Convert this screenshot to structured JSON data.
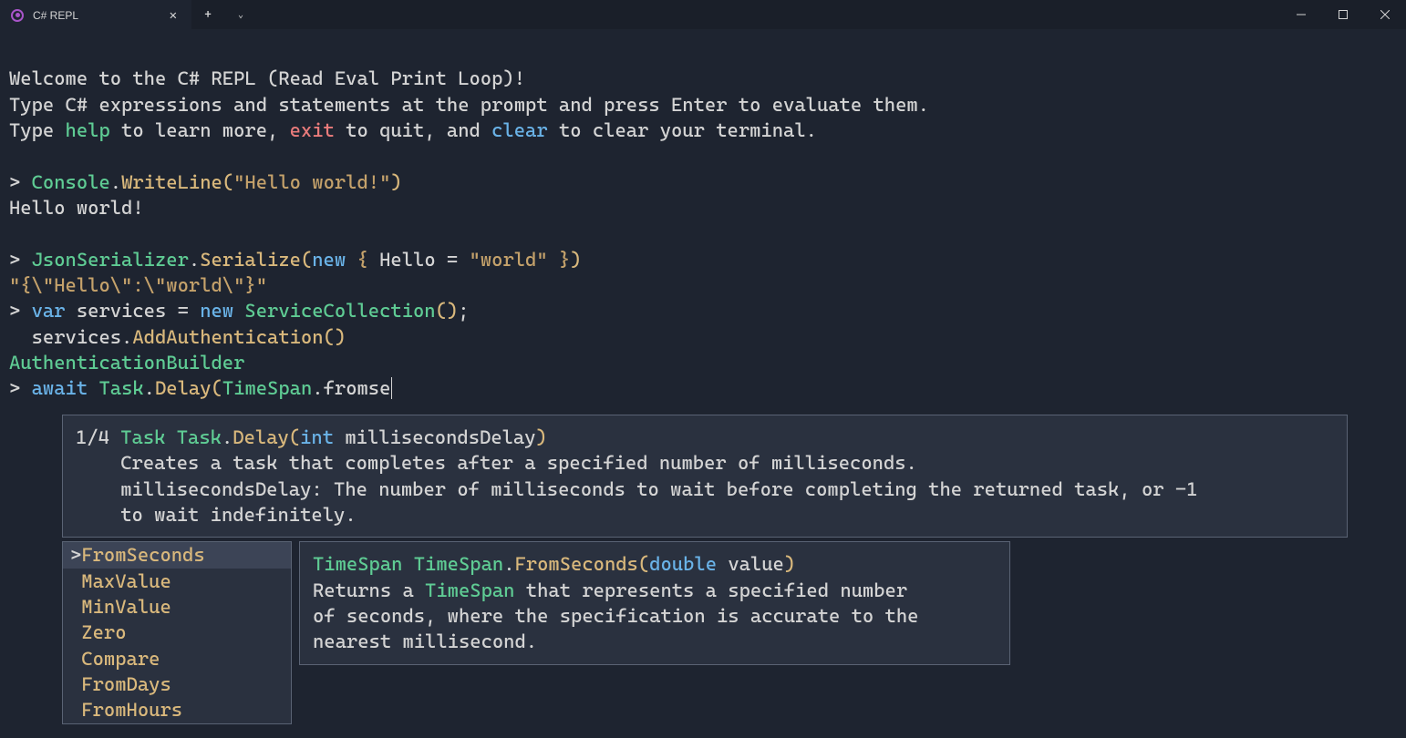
{
  "titlebar": {
    "tab_title": "C# REPL"
  },
  "intro": {
    "line1_a": "Welcome to the C# REPL (Read Eval Print Loop)!",
    "line2_a": "Type C# expressions and statements at the prompt and press Enter to evaluate them.",
    "line3_prefix": "Type ",
    "help": "help",
    "line3_mid1": " to learn more, ",
    "exit": "exit",
    "line3_mid2": " to quit, and ",
    "clear": "clear",
    "line3_suffix": " to clear your terminal."
  },
  "prompts": {
    "p": "> "
  },
  "cmd1": {
    "cls": "Console",
    "dot1": ".",
    "meth": "WriteLine",
    "open": "(",
    "str": "\"Hello world!\"",
    "close": ")",
    "output": "Hello world!"
  },
  "cmd2": {
    "cls": "JsonSerializer",
    "dot1": ".",
    "meth": "Serialize",
    "open": "(",
    "kw": "new",
    "sp": " ",
    "brace_o": "{ ",
    "prop": "Hello ",
    "eq": "= ",
    "str": "\"world\"",
    "brace_c": " }",
    "close": ")",
    "output": "\"{\\\"Hello\\\":\\\"world\\\"}\""
  },
  "cmd3": {
    "kw1": "var",
    "sp1": " services ",
    "eq": "= ",
    "kw2": "new",
    "sp2": " ",
    "cls": "ServiceCollection",
    "paren": "()",
    "semi": ";",
    "indent": "  services",
    "dot": ".",
    "meth": "AddAuthentication",
    "paren2": "()",
    "output": "AuthenticationBuilder"
  },
  "cmd4": {
    "kw": "await",
    "sp1": " ",
    "cls1": "Task",
    "dot1": ".",
    "meth": "Delay",
    "open": "(",
    "cls2": "TimeSpan",
    "dot2": ".",
    "typed": "fromse"
  },
  "signature": {
    "count": "1/4 ",
    "type1": "Task",
    "sp1": " ",
    "type2": "Task",
    "dot": ".",
    "meth": "Delay",
    "open": "(",
    "ptype": "int",
    "sp2": " ",
    "pname": "millisecondsDelay",
    "close": ")",
    "desc_indent": "    ",
    "desc1": "Creates a task that completes after a specified number of milliseconds.",
    "desc2": "millisecondsDelay: The number of milliseconds to wait before completing the returned task, or -1",
    "desc3": "to wait indefinitely."
  },
  "completions": {
    "items": [
      {
        "label": "FromSeconds",
        "selected": true
      },
      {
        "label": "MaxValue",
        "selected": false
      },
      {
        "label": "MinValue",
        "selected": false
      },
      {
        "label": "Zero",
        "selected": false
      },
      {
        "label": "Compare",
        "selected": false
      },
      {
        "label": "FromDays",
        "selected": false
      },
      {
        "label": "FromHours",
        "selected": false
      }
    ]
  },
  "memberdesc": {
    "type1": "TimeSpan",
    "sp1": " ",
    "type2": "TimeSpan",
    "dot": ".",
    "meth": "FromSeconds",
    "open": "(",
    "ptype": "double",
    "sp2": " ",
    "pname": "value",
    "close": ")",
    "line1a": "Returns a ",
    "line1type": "TimeSpan",
    "line1b": " that represents a specified number",
    "line2": "of seconds, where the specification is accurate to the",
    "line3": "nearest millisecond."
  }
}
